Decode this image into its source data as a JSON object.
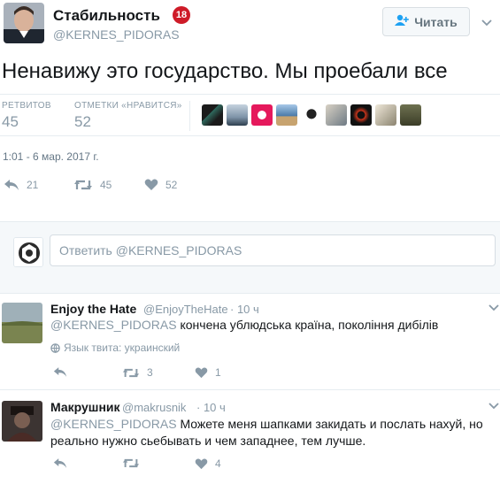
{
  "main_tweet": {
    "display_name": "Стабильность",
    "age_badge": "18",
    "handle": "@KERNES_PIDORAS",
    "follow_label": "Читать",
    "text": "Ненавижу это государство. Мы проебали все",
    "retweets_label": "РЕТВИТОВ",
    "retweets_count": "45",
    "likes_label": "ОТМЕТКИ «НРАВИТСЯ»",
    "likes_count": "52",
    "timestamp": "1:01 - 6 мар. 2017 г.",
    "actions": {
      "replies": "21",
      "retweets": "45",
      "likes": "52"
    }
  },
  "reply_composer": {
    "placeholder": "Ответить @KERNES_PIDORAS"
  },
  "replies": [
    {
      "display_name": "Enjoy the Hate",
      "handle": "@EnjoyTheHate",
      "time": "· 10 ч",
      "mention": "@KERNES_PIDORAS",
      "text": "кончена ублюдська країна, покоління дибілів",
      "language_note": "Язык твита: украинский",
      "actions": {
        "replies": "",
        "retweets": "3",
        "likes": "1"
      }
    },
    {
      "display_name": "Макрушник",
      "handle": "@makrusnik",
      "time": "· 10 ч",
      "mention": "@KERNES_PIDORAS",
      "text_line1": "Можете меня шапками закидать и послать нахуй, но",
      "text_line2": "реально нужно сьебывать и чем западнее, тем лучше.",
      "actions": {
        "replies": "",
        "retweets": "",
        "likes": "4"
      }
    }
  ],
  "colors": {
    "muted": "#8899a6",
    "text": "#14171a",
    "badge": "#ce1b28",
    "follow_icon": "#1da1f2"
  }
}
